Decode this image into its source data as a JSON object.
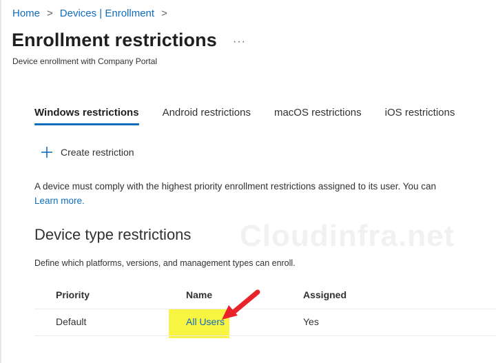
{
  "breadcrumb": {
    "items": [
      "Home",
      "Devices | Enrollment"
    ],
    "separator": ">"
  },
  "header": {
    "title": "Enrollment restrictions",
    "more": "···",
    "subtitle": "Device enrollment with Company Portal"
  },
  "tabs": [
    {
      "label": "Windows restrictions",
      "active": true
    },
    {
      "label": "Android restrictions",
      "active": false
    },
    {
      "label": "macOS restrictions",
      "active": false
    },
    {
      "label": "iOS restrictions",
      "active": false
    }
  ],
  "toolbar": {
    "create_label": "Create restriction",
    "create_icon": "plus-icon"
  },
  "info": {
    "text": "A device must comply with the highest priority enrollment restrictions assigned to its user. You can",
    "learn_more": "Learn more."
  },
  "section": {
    "title": "Device type restrictions",
    "description": "Define which platforms, versions, and management types can enroll."
  },
  "watermark": "Cloudinfra.net",
  "table": {
    "columns": [
      "Priority",
      "Name",
      "Assigned"
    ],
    "rows": [
      {
        "priority": "Default",
        "name": "All Users",
        "assigned": "Yes"
      }
    ]
  },
  "colors": {
    "accent": "#0f6cbd",
    "highlight": "#f7f542",
    "annotation_arrow": "#e8232a"
  }
}
